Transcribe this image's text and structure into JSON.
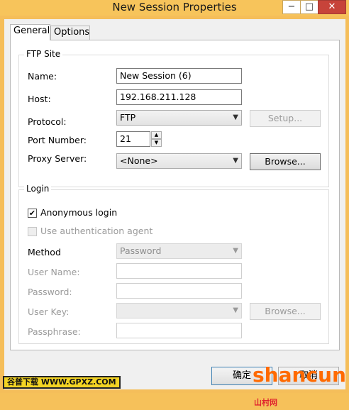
{
  "window": {
    "title": "New Session Properties",
    "close_glyph": "✕",
    "min_glyph": "−",
    "max_glyph": "□"
  },
  "tabs": [
    {
      "label": "General"
    },
    {
      "label": "Options"
    }
  ],
  "ftp_site": {
    "title": "FTP Site",
    "name_label": "Name:",
    "name_value": "New Session (6)",
    "host_label": "Host:",
    "host_value": "192.168.211.128",
    "protocol_label": "Protocol:",
    "protocol_value": "FTP",
    "setup_label": "Setup...",
    "port_label": "Port Number:",
    "port_value": "21",
    "proxy_label": "Proxy Server:",
    "proxy_value": "<None>",
    "browse_label": "Browse..."
  },
  "login": {
    "title": "Login",
    "anonymous_label": "Anonymous login",
    "anonymous_checked": true,
    "auth_agent_label": "Use authentication agent",
    "method_label": "Method",
    "method_value": "Password",
    "username_label": "User Name:",
    "password_label": "Password:",
    "userkey_label": "User Key:",
    "userkey_browse_label": "Browse...",
    "passphrase_label": "Passphrase:"
  },
  "footer": {
    "ok_label": "确定",
    "cancel_label": "取消"
  },
  "watermarks": {
    "left": "谷普下载 WWW.GPXZ.COM",
    "right": "shancun",
    "right_cn": "山村网"
  }
}
